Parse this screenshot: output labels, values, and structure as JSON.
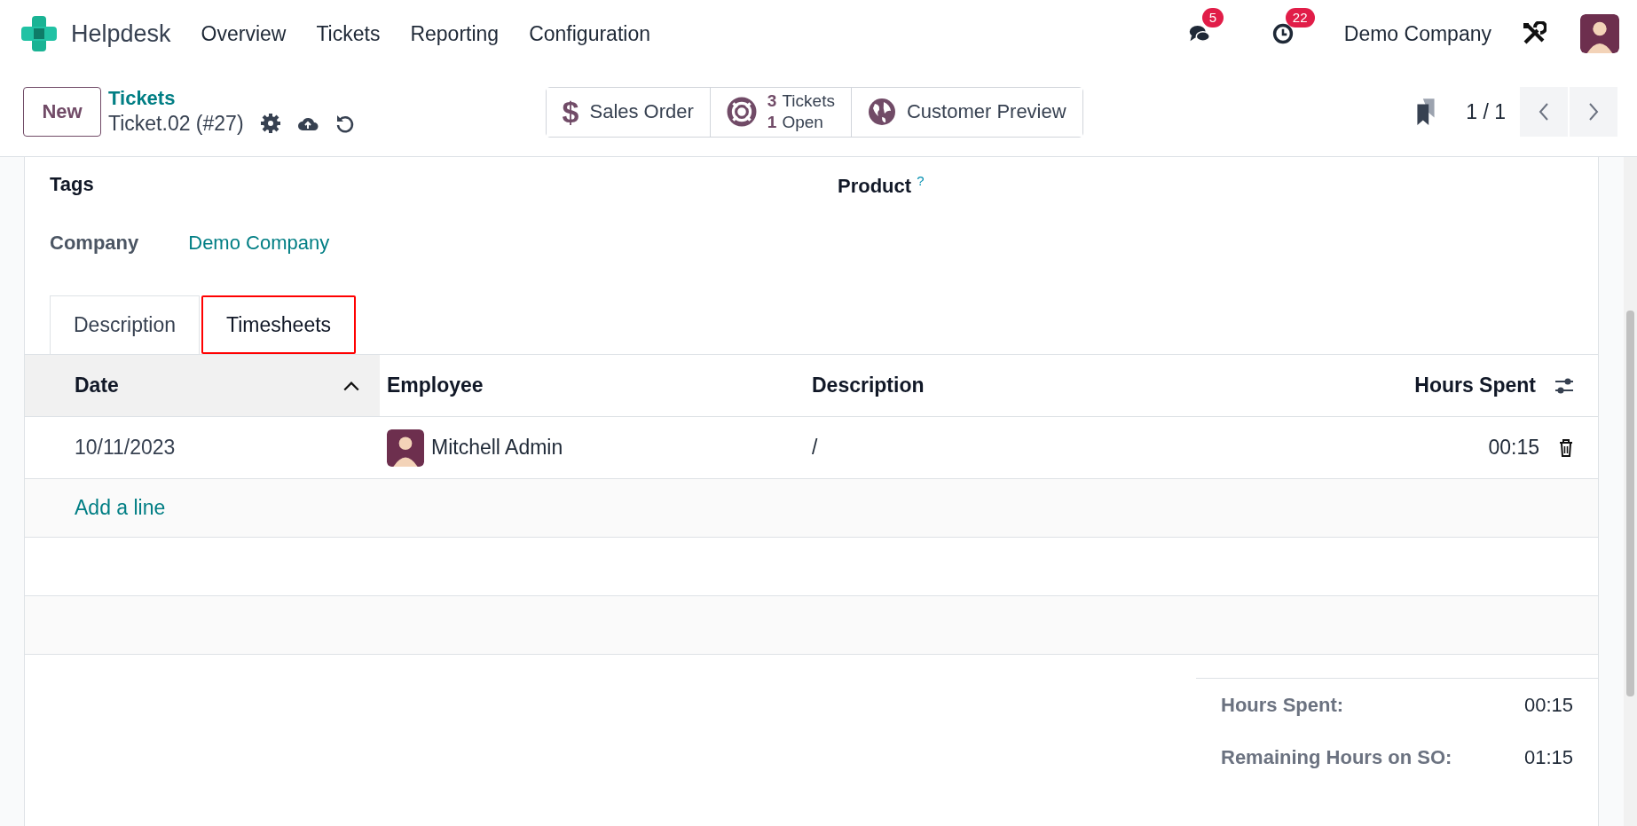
{
  "navbar": {
    "app_name": "Helpdesk",
    "menu": [
      "Overview",
      "Tickets",
      "Reporting",
      "Configuration"
    ],
    "messages_badge": "5",
    "activities_badge": "22",
    "company": "Demo Company"
  },
  "control_panel": {
    "new_button": "New",
    "breadcrumb": "Tickets",
    "record_title": "Ticket.02 (#27)",
    "smart_buttons": [
      {
        "kind": "dollar",
        "symbol": "$",
        "label": "Sales Order"
      },
      {
        "kind": "stat",
        "lines": [
          "**3** Tickets",
          "**1** Open"
        ]
      },
      {
        "kind": "globe",
        "label": "Customer Preview"
      }
    ],
    "pager": "1 / 1"
  },
  "form": {
    "tags_label": "Tags",
    "product_label": "Product",
    "product_help": "?",
    "company_label": "Company",
    "company_value": "Demo Company"
  },
  "tabs": [
    {
      "label": "Description",
      "selected": false,
      "highlighted": false
    },
    {
      "label": "Timesheets",
      "selected": true,
      "highlighted": true
    }
  ],
  "table": {
    "columns": [
      {
        "label": "Date",
        "sorted": true
      },
      {
        "label": "Employee",
        "sorted": false
      },
      {
        "label": "Description",
        "sorted": false
      },
      {
        "label": "Hours Spent",
        "sorted": false
      }
    ],
    "rows": [
      {
        "date": "10/11/2023",
        "employee": "Mitchell Admin",
        "description": "/",
        "hours": "00:15"
      }
    ],
    "add_line": "Add a line"
  },
  "totals": [
    {
      "label": "Hours Spent:",
      "value": "00:15"
    },
    {
      "label": "Remaining Hours on SO:",
      "value": "01:15"
    }
  ]
}
